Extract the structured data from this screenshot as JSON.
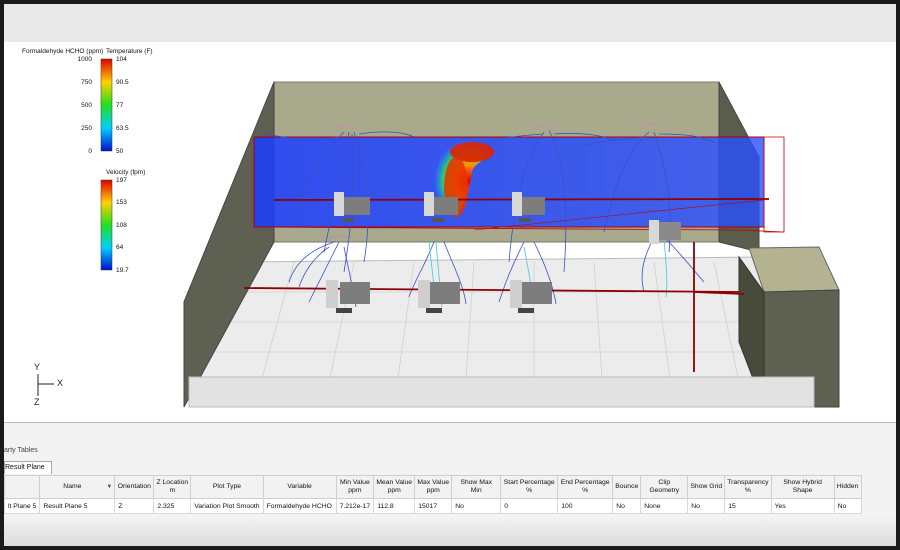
{
  "legend": {
    "hcho_title": "Formaldehyde HCHO (ppm)",
    "hcho_ticks": [
      "1000",
      "750",
      "500",
      "250",
      "0"
    ],
    "temp_title": "Temperature (F)",
    "temp_ticks": [
      "104",
      "90.5",
      "77",
      "63.5",
      "50"
    ],
    "vel_title": "Velocity (fpm)",
    "vel_ticks": [
      "197",
      "153",
      "108",
      "64",
      "19.7"
    ]
  },
  "axes": {
    "y": "Y",
    "x": "X",
    "z": "Z"
  },
  "panel": {
    "title": "arty Tables",
    "tab_label": "Result Plane"
  },
  "table": {
    "headers": [
      {
        "top": "",
        "bottom": ""
      },
      {
        "top": "Name",
        "bottom": ""
      },
      {
        "top": "Orientation",
        "bottom": ""
      },
      {
        "top": "Z Location",
        "bottom": "m"
      },
      {
        "top": "Plot Type",
        "bottom": ""
      },
      {
        "top": "Variable",
        "bottom": ""
      },
      {
        "top": "Min Value",
        "bottom": "ppm"
      },
      {
        "top": "Mean Value",
        "bottom": "ppm"
      },
      {
        "top": "Max Value",
        "bottom": "ppm"
      },
      {
        "top": "Show Max Min",
        "bottom": ""
      },
      {
        "top": "Start Percentage",
        "bottom": "%"
      },
      {
        "top": "End Percentage",
        "bottom": "%"
      },
      {
        "top": "Bounce",
        "bottom": ""
      },
      {
        "top": "Clip Geometry",
        "bottom": ""
      },
      {
        "top": "Show Grid",
        "bottom": ""
      },
      {
        "top": "Transparency",
        "bottom": "%"
      },
      {
        "top": "Show Hybrid Shape",
        "bottom": ""
      },
      {
        "top": "Hidden",
        "bottom": ""
      }
    ],
    "row": [
      "lt Plane 5",
      "Result Plane 5",
      "Z",
      "2.325",
      "Variation Plot Smooth",
      "Formaldehyde HCHO",
      "7.212e-17",
      "112.8",
      "15017",
      "No",
      "0",
      "100",
      "No",
      "None",
      "No",
      "15",
      "Yes",
      "No"
    ]
  },
  "colors": {
    "plane_blue": "#1a3cff",
    "wall": "#a8a88a",
    "floor": "#e8e8e8",
    "pipe": "#8b0000"
  }
}
